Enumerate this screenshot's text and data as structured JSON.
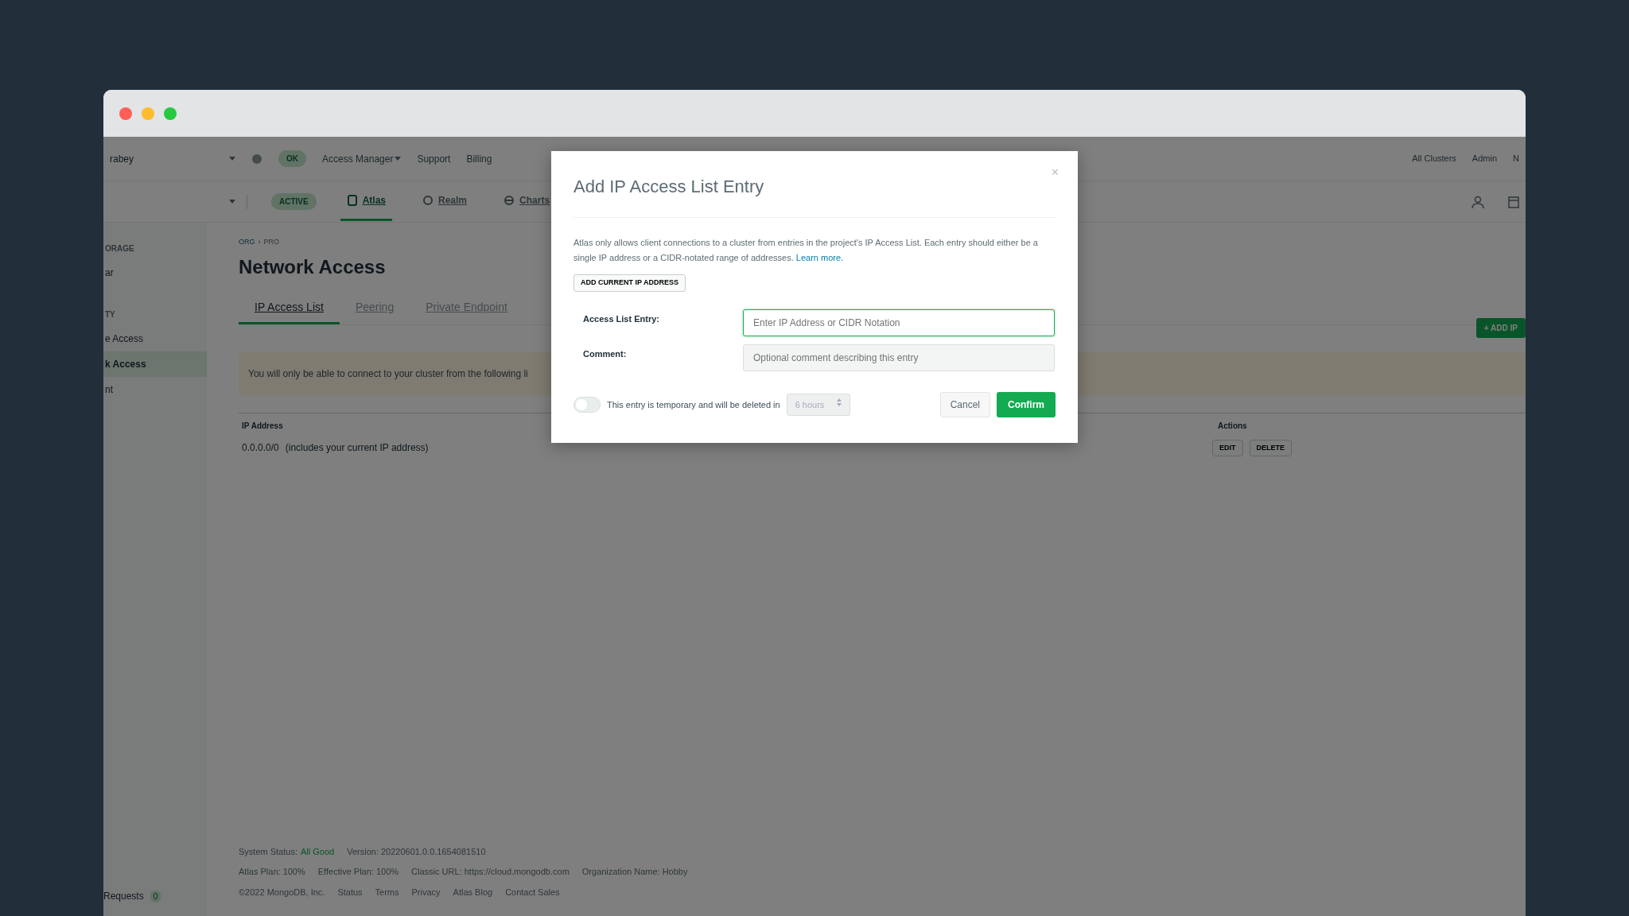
{
  "top_nav": {
    "org": "rabey",
    "status_badge": "OK",
    "links": [
      "Access Manager",
      "Support",
      "Billing"
    ],
    "right_links": [
      "All Clusters",
      "Admin",
      "N"
    ]
  },
  "project_nav": {
    "status_badge": "ACTIVE",
    "tabs": [
      {
        "label": "Atlas",
        "selected": true
      },
      {
        "label": "Realm",
        "selected": false
      },
      {
        "label": "Charts",
        "selected": false
      }
    ]
  },
  "sidebar": {
    "items": [
      {
        "label": "ORAGE",
        "kind": "header",
        "selected": false
      },
      {
        "label": "ar",
        "kind": "item",
        "selected": false
      },
      {
        "label": "TY",
        "kind": "header",
        "selected": false
      },
      {
        "label": "e Access",
        "kind": "item",
        "selected": false
      },
      {
        "label": "k Access",
        "kind": "item",
        "selected": true
      },
      {
        "label": "nt",
        "kind": "item",
        "selected": false
      }
    ],
    "requests_label": "Requests",
    "requests_count": "0"
  },
  "page": {
    "breadcrumb": [
      "ORG",
      "PRO"
    ],
    "breadcrumb_separator": "›",
    "title": "Network Access",
    "tabs": [
      {
        "label": "IP Access List",
        "selected": true
      },
      {
        "label": "Peering",
        "selected": false
      },
      {
        "label": "Private Endpoint",
        "selected": false
      }
    ],
    "add_button": "+ ADD IP",
    "banner": "You will only be able to connect to your cluster from the following li",
    "table": {
      "columns": [
        "IP Address",
        "Actions"
      ],
      "rows": [
        {
          "ip": "0.0.0.0/0",
          "note": "(includes your current IP address)",
          "actions": [
            "EDIT",
            "DELETE"
          ]
        }
      ]
    }
  },
  "footer": {
    "lines": [
      [
        "System Status:",
        "All Good",
        "Version: 20220601.0.0.1654081510"
      ],
      [
        "Atlas Plan: 100%",
        "Effective Plan: 100%",
        "Classic URL: https://cloud.mongodb.com",
        "Organization Name: Hobby"
      ],
      [
        "©2022 MongoDB, Inc.",
        "Status",
        "Terms",
        "Privacy",
        "Atlas Blog",
        "Contact Sales"
      ]
    ]
  },
  "modal": {
    "title": "Add IP Access List Entry",
    "close": "×",
    "description": "Atlas only allows client connections to a cluster from entries in the project's IP Access List. Each entry should either be a single IP address or a CIDR-notated range of addresses.",
    "learn_more": "Learn more.",
    "add_current_button": "ADD CURRENT IP ADDRESS",
    "fields": [
      {
        "label": "Access List Entry:",
        "placeholder": "Enter IP Address or CIDR Notation",
        "focused": true,
        "disabled": false
      },
      {
        "label": "Comment:",
        "placeholder": "Optional comment describing this entry",
        "focused": false,
        "disabled": true
      }
    ],
    "temporary": {
      "on": false,
      "label": "This entry is temporary and will be deleted in",
      "select_value": "6 hours",
      "select_disabled": true
    },
    "buttons": [
      "Cancel",
      "Confirm"
    ]
  }
}
